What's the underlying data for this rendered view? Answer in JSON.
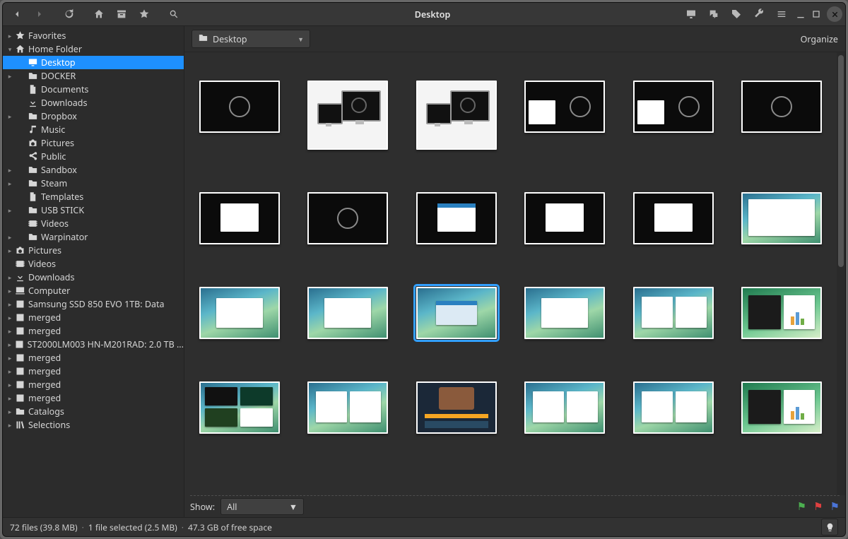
{
  "window_title": "Desktop",
  "toolbar_icons": [
    "back",
    "forward",
    "history",
    "home",
    "archive",
    "bookmark",
    "search"
  ],
  "toolbar_icons_right": [
    "monitor",
    "comments",
    "tags",
    "wrench",
    "menu",
    "minimize",
    "maximize",
    "close"
  ],
  "location": {
    "label": "Desktop"
  },
  "organize_label": "Organize",
  "sidebar": [
    {
      "exp": "▸",
      "indent": 0,
      "icon": "star",
      "label": "Favorites"
    },
    {
      "exp": "▾",
      "indent": 0,
      "icon": "home",
      "label": "Home Folder"
    },
    {
      "exp": "",
      "indent": 1,
      "icon": "desktop",
      "label": "Desktop",
      "selected": true
    },
    {
      "exp": "▸",
      "indent": 1,
      "icon": "folder",
      "label": "DOCKER"
    },
    {
      "exp": "",
      "indent": 1,
      "icon": "file",
      "label": "Documents"
    },
    {
      "exp": "",
      "indent": 1,
      "icon": "download",
      "label": "Downloads"
    },
    {
      "exp": "▸",
      "indent": 1,
      "icon": "folder",
      "label": "Dropbox"
    },
    {
      "exp": "",
      "indent": 1,
      "icon": "music",
      "label": "Music"
    },
    {
      "exp": "",
      "indent": 1,
      "icon": "camera",
      "label": "Pictures"
    },
    {
      "exp": "",
      "indent": 1,
      "icon": "share",
      "label": "Public"
    },
    {
      "exp": "▸",
      "indent": 1,
      "icon": "folder",
      "label": "Sandbox"
    },
    {
      "exp": "▸",
      "indent": 1,
      "icon": "folder",
      "label": "Steam"
    },
    {
      "exp": "",
      "indent": 1,
      "icon": "file",
      "label": "Templates"
    },
    {
      "exp": "▸",
      "indent": 1,
      "icon": "folder",
      "label": "USB STICK"
    },
    {
      "exp": "",
      "indent": 1,
      "icon": "video",
      "label": "Videos"
    },
    {
      "exp": "▸",
      "indent": 1,
      "icon": "folder",
      "label": "Warpinator"
    },
    {
      "exp": "▸",
      "indent": 0,
      "icon": "camera",
      "label": "Pictures"
    },
    {
      "exp": "",
      "indent": 0,
      "icon": "video",
      "label": "Videos"
    },
    {
      "exp": "▸",
      "indent": 0,
      "icon": "download",
      "label": "Downloads"
    },
    {
      "exp": "▸",
      "indent": 0,
      "icon": "computer",
      "label": "Computer"
    },
    {
      "exp": "▸",
      "indent": 0,
      "icon": "disk",
      "label": "Samsung SSD 850 EVO 1TB: Data"
    },
    {
      "exp": "▸",
      "indent": 0,
      "icon": "disk",
      "label": "merged"
    },
    {
      "exp": "▸",
      "indent": 0,
      "icon": "disk",
      "label": "merged"
    },
    {
      "exp": "▸",
      "indent": 0,
      "icon": "disk",
      "label": "ST2000LM003 HN-M201RAD: 2.0 TB ..."
    },
    {
      "exp": "▸",
      "indent": 0,
      "icon": "disk",
      "label": "merged"
    },
    {
      "exp": "▸",
      "indent": 0,
      "icon": "disk",
      "label": "merged"
    },
    {
      "exp": "▸",
      "indent": 0,
      "icon": "disk",
      "label": "merged"
    },
    {
      "exp": "▸",
      "indent": 0,
      "icon": "disk",
      "label": "merged"
    },
    {
      "exp": "▸",
      "indent": 0,
      "icon": "folder",
      "label": "Catalogs"
    },
    {
      "exp": "▸",
      "indent": 0,
      "icon": "library",
      "label": "Selections"
    }
  ],
  "filter": {
    "label": "Show:",
    "value": "All"
  },
  "thumbnails": [
    {
      "style": "black-ring"
    },
    {
      "style": "monitors",
      "tall": true
    },
    {
      "style": "monitors",
      "tall": true
    },
    {
      "style": "black-win-left"
    },
    {
      "style": "black-win-left"
    },
    {
      "style": "black-ring"
    },
    {
      "style": "black-win-center"
    },
    {
      "style": "black-ring"
    },
    {
      "style": "black-win-center-blue"
    },
    {
      "style": "black-win-center"
    },
    {
      "style": "black-win-center"
    },
    {
      "style": "blue-full"
    },
    {
      "style": "blue-win"
    },
    {
      "style": "blue-win"
    },
    {
      "style": "blue-center",
      "selected": true
    },
    {
      "style": "blue-win"
    },
    {
      "style": "blue-two"
    },
    {
      "style": "green-two"
    },
    {
      "style": "blue-quad"
    },
    {
      "style": "blue-two"
    },
    {
      "style": "steam"
    },
    {
      "style": "blue-two"
    },
    {
      "style": "blue-two"
    },
    {
      "style": "green-two"
    }
  ],
  "status": {
    "files": "72 files (39.8 MB)",
    "selected": "1 file selected (2.5 MB)",
    "free": "47.3 GB of free space"
  }
}
